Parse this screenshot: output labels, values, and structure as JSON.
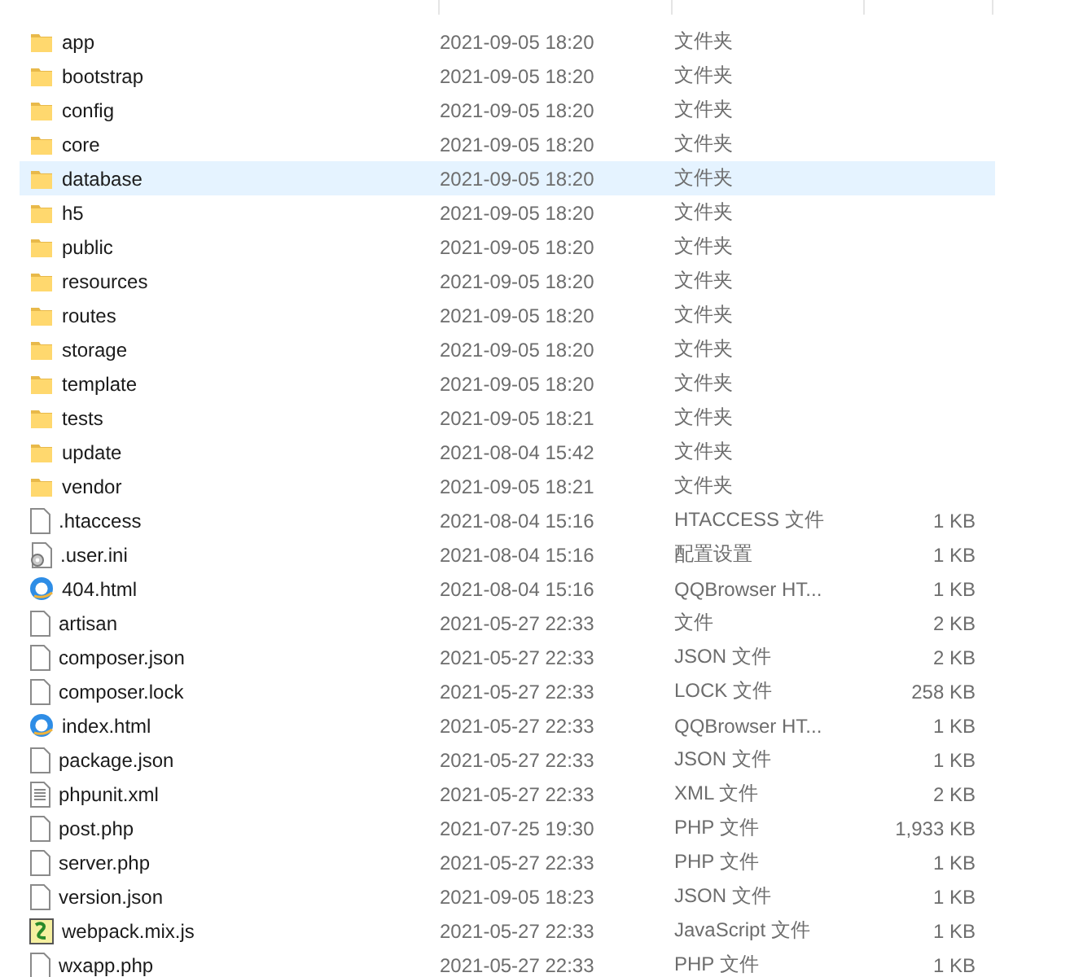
{
  "rows": [
    {
      "kind": "folder",
      "name": "app",
      "modified": "2021-09-05 18:20",
      "type": "文件夹",
      "selected": false
    },
    {
      "kind": "folder",
      "name": "bootstrap",
      "modified": "2021-09-05 18:20",
      "type": "文件夹",
      "selected": false
    },
    {
      "kind": "folder",
      "name": "config",
      "modified": "2021-09-05 18:20",
      "type": "文件夹",
      "selected": false
    },
    {
      "kind": "folder",
      "name": "core",
      "modified": "2021-09-05 18:20",
      "type": "文件夹",
      "selected": false
    },
    {
      "kind": "folder",
      "name": "database",
      "modified": "2021-09-05 18:20",
      "type": "文件夹",
      "selected": true
    },
    {
      "kind": "folder",
      "name": "h5",
      "modified": "2021-09-05 18:20",
      "type": "文件夹",
      "selected": false
    },
    {
      "kind": "folder",
      "name": "public",
      "modified": "2021-09-05 18:20",
      "type": "文件夹",
      "selected": false
    },
    {
      "kind": "folder",
      "name": "resources",
      "modified": "2021-09-05 18:20",
      "type": "文件夹",
      "selected": false
    },
    {
      "kind": "folder",
      "name": "routes",
      "modified": "2021-09-05 18:20",
      "type": "文件夹",
      "selected": false
    },
    {
      "kind": "folder",
      "name": "storage",
      "modified": "2021-09-05 18:20",
      "type": "文件夹",
      "selected": false
    },
    {
      "kind": "folder",
      "name": "template",
      "modified": "2021-09-05 18:20",
      "type": "文件夹",
      "selected": false
    },
    {
      "kind": "folder",
      "name": "tests",
      "modified": "2021-09-05 18:21",
      "type": "文件夹",
      "selected": false
    },
    {
      "kind": "folder",
      "name": "update",
      "modified": "2021-08-04 15:42",
      "type": "文件夹",
      "selected": false
    },
    {
      "kind": "folder",
      "name": "vendor",
      "modified": "2021-09-05 18:21",
      "type": "文件夹",
      "selected": false
    },
    {
      "kind": "file",
      "name": ".htaccess",
      "modified": "2021-08-04 15:16",
      "type": "HTACCESS 文件",
      "size": "1 KB",
      "selected": false
    },
    {
      "kind": "config",
      "name": ".user.ini",
      "modified": "2021-08-04 15:16",
      "type": "配置设置",
      "size": "1 KB",
      "selected": false
    },
    {
      "kind": "browser",
      "name": "404.html",
      "modified": "2021-08-04 15:16",
      "type": "QQBrowser HT...",
      "size": "1 KB",
      "selected": false
    },
    {
      "kind": "file",
      "name": "artisan",
      "modified": "2021-05-27 22:33",
      "type": "文件",
      "size": "2 KB",
      "selected": false
    },
    {
      "kind": "file",
      "name": "composer.json",
      "modified": "2021-05-27 22:33",
      "type": "JSON 文件",
      "size": "2 KB",
      "selected": false
    },
    {
      "kind": "file",
      "name": "composer.lock",
      "modified": "2021-05-27 22:33",
      "type": "LOCK 文件",
      "size": "258 KB",
      "selected": false
    },
    {
      "kind": "browser",
      "name": "index.html",
      "modified": "2021-05-27 22:33",
      "type": "QQBrowser HT...",
      "size": "1 KB",
      "selected": false
    },
    {
      "kind": "file",
      "name": "package.json",
      "modified": "2021-05-27 22:33",
      "type": "JSON 文件",
      "size": "1 KB",
      "selected": false
    },
    {
      "kind": "text",
      "name": "phpunit.xml",
      "modified": "2021-05-27 22:33",
      "type": "XML 文件",
      "size": "2 KB",
      "selected": false
    },
    {
      "kind": "file",
      "name": "post.php",
      "modified": "2021-07-25 19:30",
      "type": "PHP 文件",
      "size": "1,933 KB",
      "selected": false
    },
    {
      "kind": "file",
      "name": "server.php",
      "modified": "2021-05-27 22:33",
      "type": "PHP 文件",
      "size": "1 KB",
      "selected": false
    },
    {
      "kind": "file",
      "name": "version.json",
      "modified": "2021-09-05 18:23",
      "type": "JSON 文件",
      "size": "1 KB",
      "selected": false
    },
    {
      "kind": "script",
      "name": "webpack.mix.js",
      "modified": "2021-05-27 22:33",
      "type": "JavaScript 文件",
      "size": "1 KB",
      "selected": false
    },
    {
      "kind": "file",
      "name": "wxapp.php",
      "modified": "2021-05-27 22:33",
      "type": "PHP 文件",
      "size": "1 KB",
      "selected": false
    }
  ]
}
